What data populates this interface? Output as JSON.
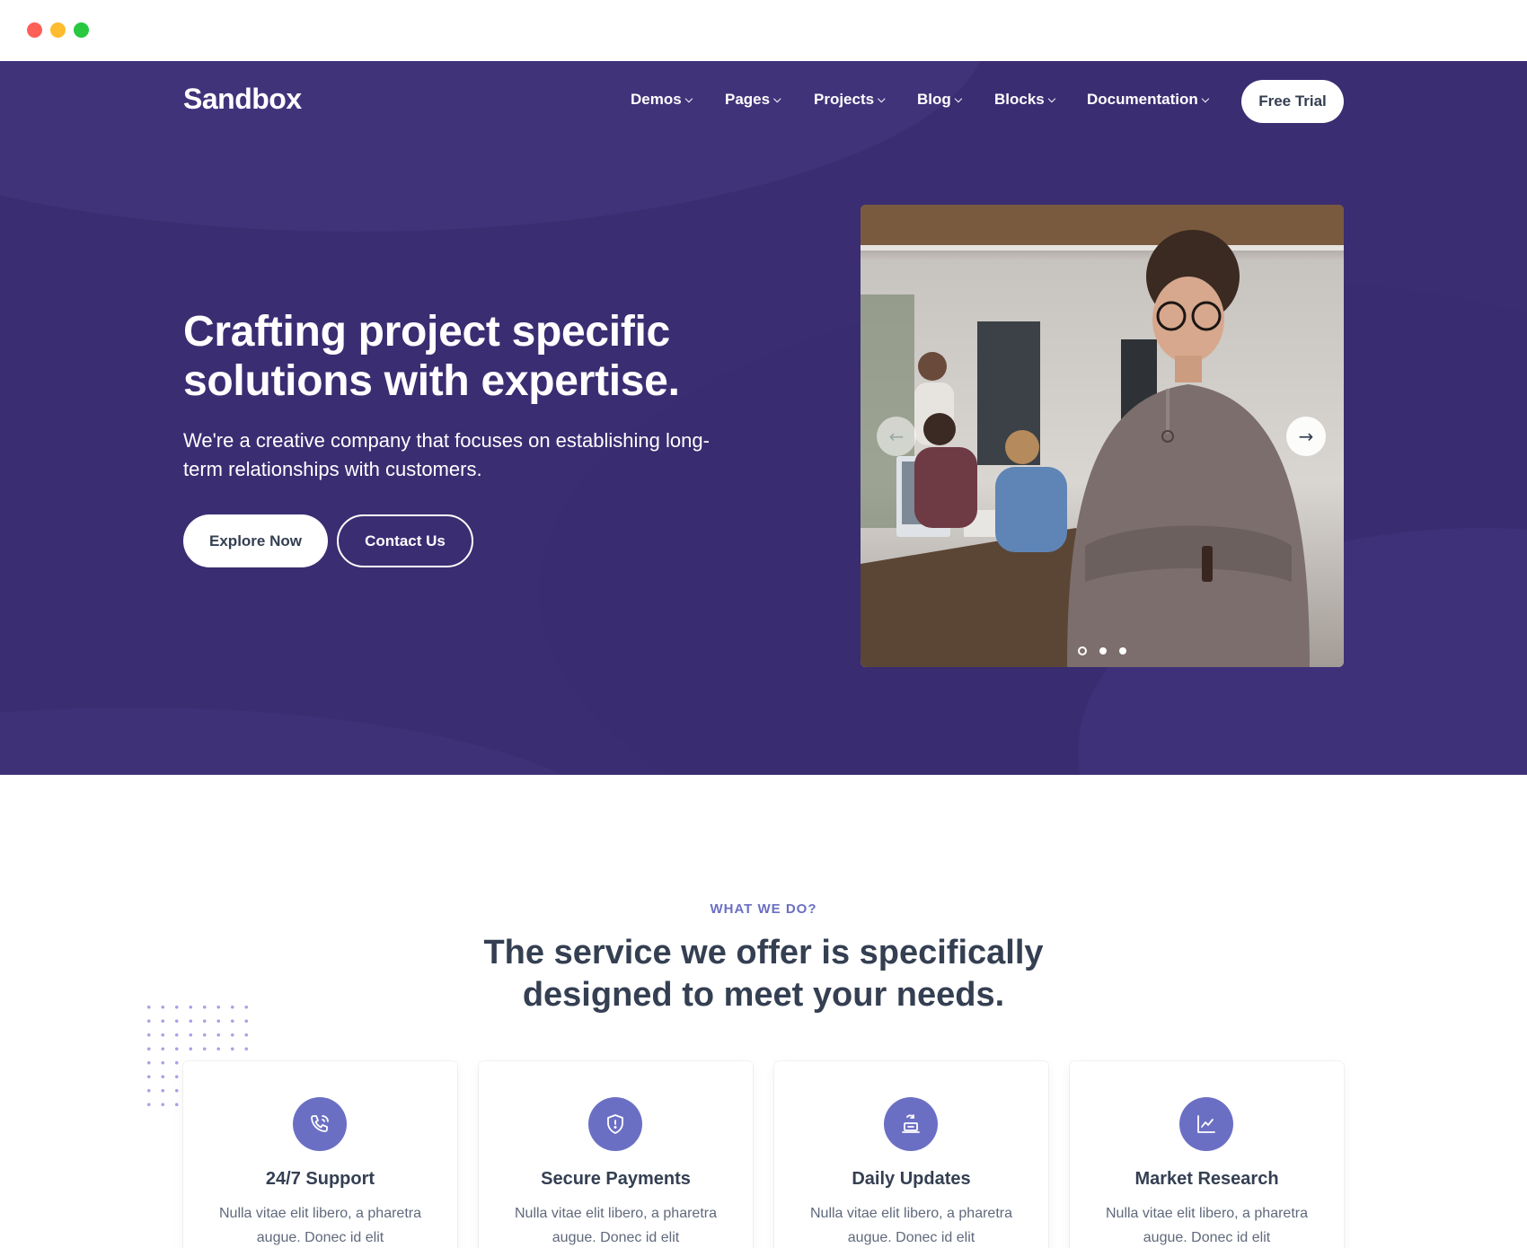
{
  "window": {
    "controls": [
      "close",
      "minimize",
      "maximize"
    ]
  },
  "header": {
    "logo": "Sandbox",
    "nav": [
      {
        "label": "Demos",
        "icon": "chevron-down-icon"
      },
      {
        "label": "Pages",
        "icon": "chevron-down-icon"
      },
      {
        "label": "Projects",
        "icon": "chevron-down-icon"
      },
      {
        "label": "Blog",
        "icon": "chevron-down-icon"
      },
      {
        "label": "Blocks",
        "icon": "chevron-down-icon"
      },
      {
        "label": "Documentation",
        "icon": "chevron-down-icon"
      }
    ],
    "cta_label": "Free Trial"
  },
  "hero": {
    "title": "Crafting project specific solutions with expertise.",
    "subtitle": "We're a creative company that focuses on establishing long-term relationships with customers.",
    "primary_button": "Explore Now",
    "secondary_button": "Contact Us",
    "slider": {
      "prev_icon": "arrow-left-icon",
      "next_icon": "arrow-right-icon",
      "slide_count": 3,
      "active_slide": 1
    }
  },
  "services": {
    "eyebrow": "WHAT WE DO?",
    "title": "The service we offer is specifically designed to meet your needs.",
    "cards": [
      {
        "icon": "phone-call-icon",
        "title": "24/7 Support",
        "text": "Nulla vitae elit libero, a pharetra augue. Donec id elit"
      },
      {
        "icon": "shield-icon",
        "title": "Secure Payments",
        "text": "Nulla vitae elit libero, a pharetra augue. Donec id elit"
      },
      {
        "icon": "laptop-update-icon",
        "title": "Daily Updates",
        "text": "Nulla vitae elit libero, a pharetra augue. Donec id elit"
      },
      {
        "icon": "chart-line-icon",
        "title": "Market Research",
        "text": "Nulla vitae elit libero, a pharetra augue. Donec id elit"
      }
    ]
  },
  "colors": {
    "hero_bg": "#3b2d72",
    "accent": "#6b6fc4",
    "heading": "#343f52",
    "body_text": "#60697b"
  }
}
